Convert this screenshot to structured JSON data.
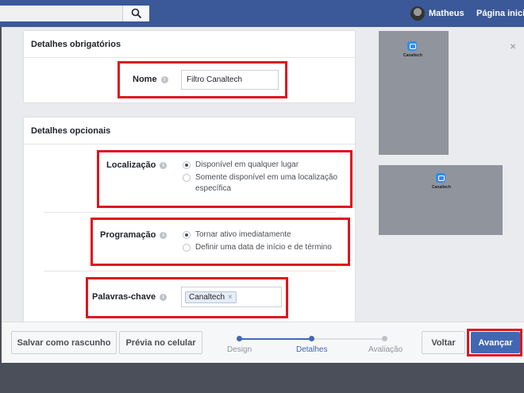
{
  "topbar": {
    "profile_name": "Matheus",
    "home_link": "Página inicial"
  },
  "required": {
    "title": "Detalhes obrigatórios",
    "name_label": "Nome",
    "name_value": "Filtro Canaltech"
  },
  "optional": {
    "title": "Detalhes opcionais",
    "location_label": "Localização",
    "location_options": [
      {
        "label": "Disponível em qualquer lugar",
        "selected": true
      },
      {
        "label": "Somente disponível em uma localização específica",
        "selected": false
      }
    ],
    "schedule_label": "Programação",
    "schedule_options": [
      {
        "label": "Tornar ativo imediatamente",
        "selected": true
      },
      {
        "label": "Definir uma data de início e de término",
        "selected": false
      }
    ],
    "keywords_label": "Palavras-chave",
    "keywords": [
      "Canaltech"
    ]
  },
  "preview": {
    "brand": "Canaltech"
  },
  "footer": {
    "save_draft": "Salvar como rascunho",
    "mobile_preview": "Prévia no celular",
    "steps": [
      {
        "label": "Design",
        "state": "done"
      },
      {
        "label": "Detalhes",
        "state": "current"
      },
      {
        "label": "Avaliação",
        "state": "pending"
      }
    ],
    "back": "Voltar",
    "next": "Avançar"
  },
  "colors": {
    "brand_blue": "#3b5998",
    "primary_button": "#4267b2",
    "highlight_red": "#e0141e",
    "stepper_active": "#4267b2"
  }
}
